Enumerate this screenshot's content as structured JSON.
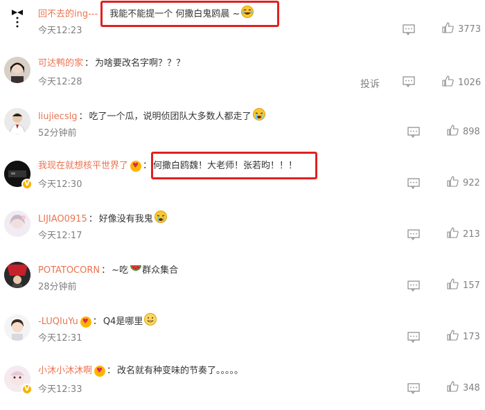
{
  "comments": [
    {
      "user": "回不去的ing---",
      "sep": "：",
      "text": "我能不能提一个 何撒白鬼鸥晨 ~",
      "emoji": "laughing-face",
      "time": "今天12:23",
      "likes": "3773",
      "verified": false
    },
    {
      "user": "可达鸭的家",
      "sep": "：",
      "text": "为啥要改名字啊？？？",
      "emoji": "",
      "time": "今天12:28",
      "likes": "1026",
      "verified": false,
      "report": "投诉"
    },
    {
      "user": "liujiecslg",
      "sep": "：",
      "text": "吃了一个瓜，说明侦团队大多数人都走了",
      "emoji": "crying-face",
      "time": "52分钟前",
      "likes": "898",
      "verified": false
    },
    {
      "user": "我现在就想核平世界了",
      "sep": "：",
      "text": "何撒白鸥魏！大老师！张若昀！！！",
      "emoji": "",
      "time": "今天12:30",
      "likes": "922",
      "verified": true
    },
    {
      "user": "LIJIAO0915",
      "sep": "：",
      "text": "好像没有我鬼",
      "emoji": "crying-face",
      "time": "今天12:17",
      "likes": "213",
      "verified": false
    },
    {
      "user": "POTATOCORN",
      "sep": "：",
      "text": "~吃",
      "text2": "群众集合",
      "emoji": "watermelon",
      "time": "28分钟前",
      "likes": "157",
      "verified": false
    },
    {
      "user": "-LUQIuYu",
      "sep": "：",
      "text": "Q4是哪里",
      "emoji": "grinning-face",
      "time": "今天12:31",
      "likes": "173",
      "verified": false
    },
    {
      "user": "小沐小沐沐啊",
      "sep": "：",
      "text": "改名就有种变味的节奏了。。。。。",
      "emoji": "",
      "time": "今天12:33",
      "likes": "348",
      "verified": true
    }
  ],
  "colors": {
    "username": "#eb7350",
    "highlight": "#e02020",
    "meta": "#808080"
  }
}
